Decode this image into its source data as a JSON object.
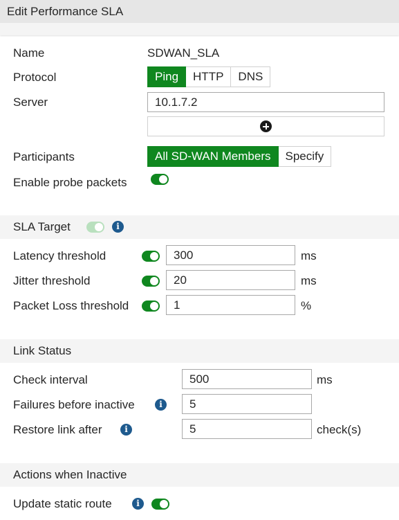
{
  "title": "Edit Performance SLA",
  "general": {
    "name_label": "Name",
    "name_value": "SDWAN_SLA",
    "protocol_label": "Protocol",
    "protocol_options": [
      "Ping",
      "HTTP",
      "DNS"
    ],
    "protocol_selected": "Ping",
    "server_label": "Server",
    "server_value": "10.1.7.2",
    "participants_label": "Participants",
    "participants_options": [
      "All SD-WAN Members",
      "Specify"
    ],
    "participants_selected": "All SD-WAN Members",
    "probe_label": "Enable probe packets",
    "probe_enabled": true
  },
  "sla_target": {
    "title": "SLA Target",
    "enabled": true,
    "rows": [
      {
        "label": "Latency threshold",
        "enabled": true,
        "value": "300",
        "unit": "ms"
      },
      {
        "label": "Jitter threshold",
        "enabled": true,
        "value": "20",
        "unit": "ms"
      },
      {
        "label": "Packet Loss threshold",
        "enabled": true,
        "value": "1",
        "unit": "%"
      }
    ]
  },
  "link_status": {
    "title": "Link Status",
    "rows": [
      {
        "label": "Check interval",
        "value": "500",
        "unit": "ms",
        "info": false
      },
      {
        "label": "Failures before inactive",
        "value": "5",
        "unit": "",
        "info": true
      },
      {
        "label": "Restore link after",
        "value": "5",
        "unit": "check(s)",
        "info": true
      }
    ]
  },
  "actions": {
    "title": "Actions when Inactive",
    "update_static_route_label": "Update static route",
    "update_static_route_enabled": true
  },
  "icons": {
    "info": "i"
  },
  "colors": {
    "accent": "#0f871f",
    "info": "#1e5a8e",
    "section_bg": "#f4f4f4",
    "title_bg": "#e6e6e6"
  }
}
